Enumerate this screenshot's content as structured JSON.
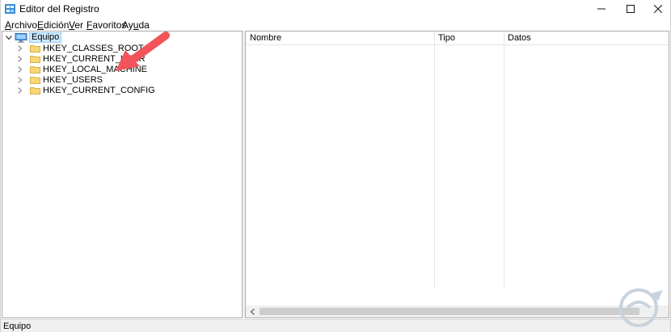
{
  "window": {
    "title": "Editor del Registro",
    "icon": "regedit-icon"
  },
  "menu": {
    "items": [
      {
        "mnemonic": "A",
        "rest": "rchivo"
      },
      {
        "mnemonic": "E",
        "rest": "dición"
      },
      {
        "mnemonic": "V",
        "rest": "er"
      },
      {
        "mnemonic": "F",
        "rest": "avoritos"
      },
      {
        "mnemonic": "",
        "pre": "Ay",
        "mnemonic2": "u",
        "rest": "da"
      }
    ]
  },
  "tree": {
    "root": {
      "label": "Equipo",
      "expanded": true,
      "selected": true
    },
    "keys": [
      {
        "label": "HKEY_CLASSES_ROOT"
      },
      {
        "label": "HKEY_CURRENT_USER"
      },
      {
        "label": "HKEY_LOCAL_MACHINE"
      },
      {
        "label": "HKEY_USERS"
      },
      {
        "label": "HKEY_CURRENT_CONFIG"
      }
    ]
  },
  "list": {
    "columns": [
      "Nombre",
      "Tipo",
      "Datos"
    ]
  },
  "status": {
    "path": "Equipo"
  },
  "colors": {
    "annotation_arrow": "#f2545b",
    "selection": "#cce8ff",
    "folder": "#f8d775"
  }
}
